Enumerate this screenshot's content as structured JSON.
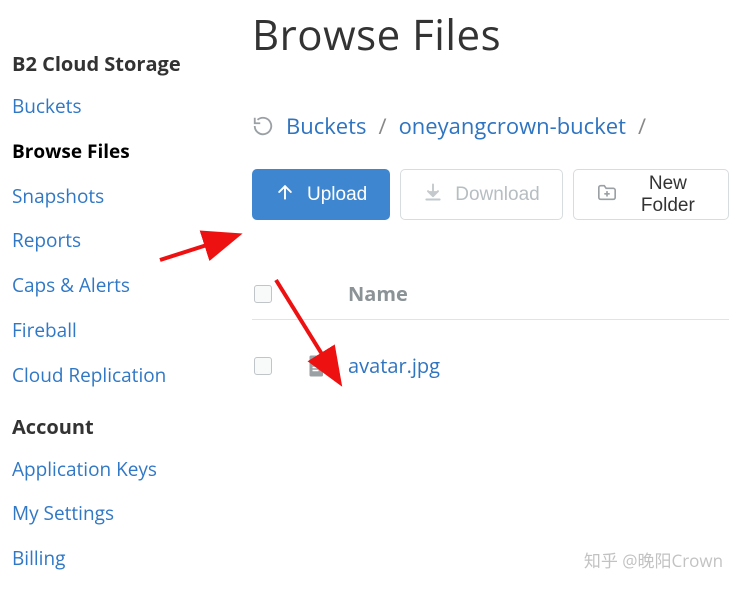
{
  "sidebar": {
    "group1_heading": "B2 Cloud Storage",
    "group1_items": [
      {
        "label": "Buckets",
        "active": false
      },
      {
        "label": "Browse Files",
        "active": true
      },
      {
        "label": "Snapshots",
        "active": false
      },
      {
        "label": "Reports",
        "active": false
      },
      {
        "label": "Caps & Alerts",
        "active": false
      },
      {
        "label": "Fireball",
        "active": false
      },
      {
        "label": "Cloud Replication",
        "active": false
      }
    ],
    "group2_heading": "Account",
    "group2_items": [
      {
        "label": "Application Keys",
        "active": false
      },
      {
        "label": "My Settings",
        "active": false
      },
      {
        "label": "Billing",
        "active": false
      }
    ]
  },
  "main": {
    "page_title": "Browse Files",
    "breadcrumb": {
      "root": "Buckets",
      "bucket": "oneyangcrown-bucket",
      "sep": "/"
    },
    "toolbar": {
      "upload_label": "Upload",
      "download_label": "Download",
      "newfolder_label": "New Folder"
    },
    "table": {
      "col_name_label": "Name",
      "rows": [
        {
          "file_name": "avatar.jpg"
        }
      ]
    }
  },
  "watermark": "知乎 @晚阳Crown"
}
